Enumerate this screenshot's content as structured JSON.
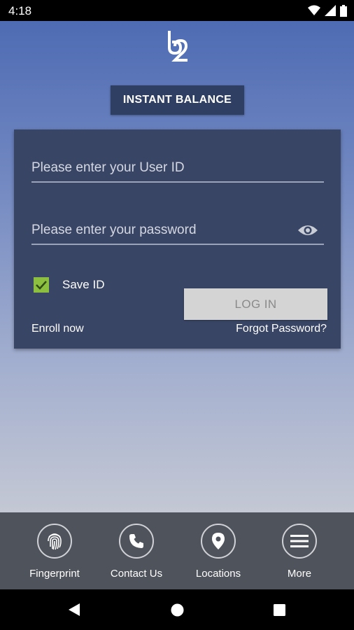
{
  "status_bar": {
    "time": "4:18"
  },
  "header": {
    "instant_balance_label": "INSTANT BALANCE"
  },
  "login": {
    "user_id_placeholder": "Please enter your User ID",
    "password_placeholder": "Please enter your password",
    "save_id_label": "Save ID",
    "save_id_checked": true,
    "login_button_label": "LOG IN",
    "enroll_label": "Enroll now",
    "forgot_password_label": "Forgot Password?"
  },
  "bottom_nav": {
    "items": [
      {
        "label": "Fingerprint",
        "icon": "fingerprint-icon"
      },
      {
        "label": "Contact Us",
        "icon": "phone-icon"
      },
      {
        "label": "Locations",
        "icon": "location-pin-icon"
      },
      {
        "label": "More",
        "icon": "menu-icon"
      }
    ]
  },
  "colors": {
    "card": "#394565",
    "button_dark": "#2f3f63",
    "checkbox": "#8cbf3f",
    "nav_bg": "#4f535b"
  }
}
